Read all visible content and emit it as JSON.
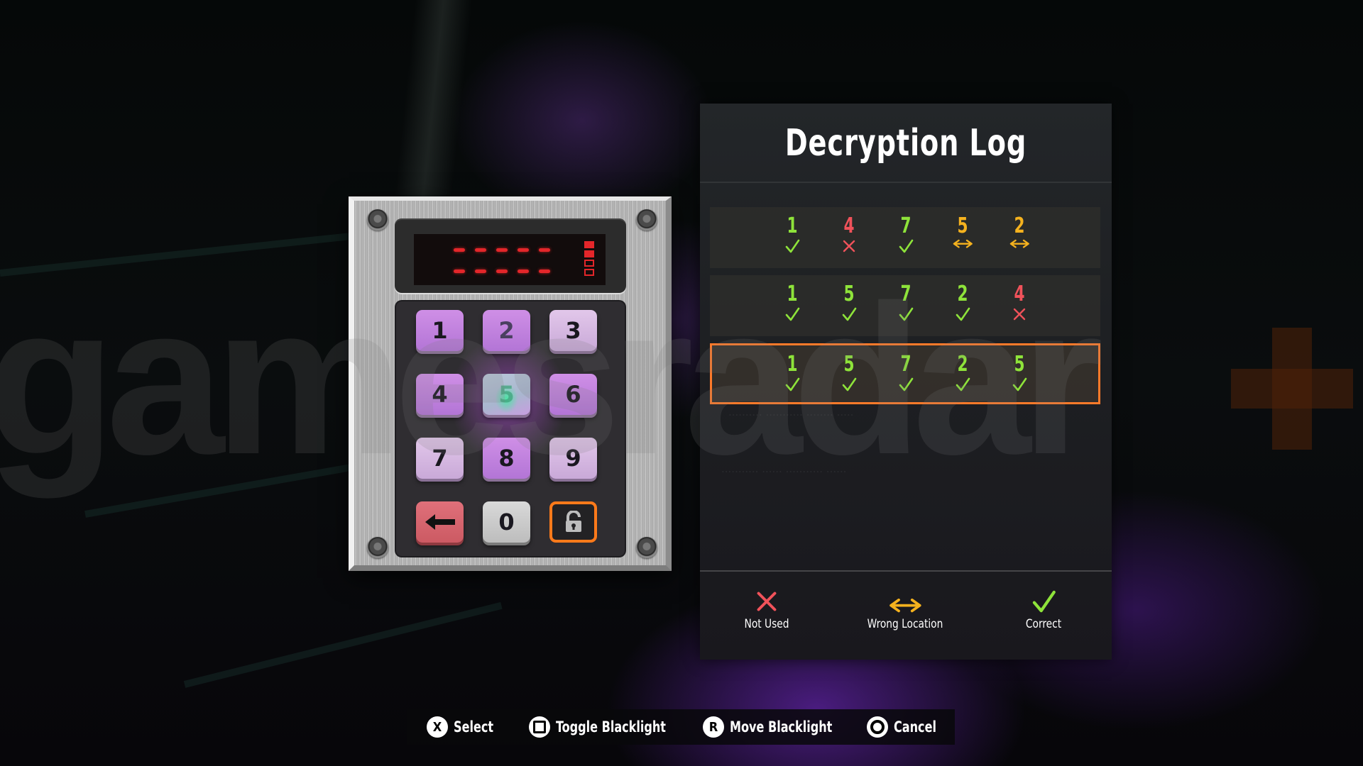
{
  "watermark": {
    "text": "gamesradar",
    "plus": "+"
  },
  "keypad": {
    "display": {
      "entered_digits": 0,
      "code_length": 5,
      "attempt_indicators": {
        "total": 4,
        "used": 2
      }
    },
    "keys": [
      {
        "label": "1",
        "state": "lit"
      },
      {
        "label": "2",
        "state": "print"
      },
      {
        "label": "3",
        "state": "normal"
      },
      {
        "label": "4",
        "state": "lit"
      },
      {
        "label": "5",
        "state": "print-strong"
      },
      {
        "label": "6",
        "state": "lit"
      },
      {
        "label": "7",
        "state": "normal"
      },
      {
        "label": "8",
        "state": "lit"
      },
      {
        "label": "9",
        "state": "normal"
      }
    ],
    "backspace_icon": "arrow-left-icon",
    "zero_label": "0",
    "enter_icon": "unlock-icon",
    "selected_key": "enter"
  },
  "log": {
    "title": "Decryption Log",
    "rows": [
      {
        "active": false,
        "entries": [
          {
            "digit": "1",
            "status": "correct"
          },
          {
            "digit": "4",
            "status": "not_used"
          },
          {
            "digit": "7",
            "status": "correct"
          },
          {
            "digit": "5",
            "status": "wrong_location"
          },
          {
            "digit": "2",
            "status": "wrong_location"
          }
        ]
      },
      {
        "active": false,
        "entries": [
          {
            "digit": "1",
            "status": "correct"
          },
          {
            "digit": "5",
            "status": "correct"
          },
          {
            "digit": "7",
            "status": "correct"
          },
          {
            "digit": "2",
            "status": "correct"
          },
          {
            "digit": "4",
            "status": "not_used"
          }
        ]
      },
      {
        "active": true,
        "entries": [
          {
            "digit": "1",
            "status": "correct"
          },
          {
            "digit": "5",
            "status": "correct"
          },
          {
            "digit": "7",
            "status": "correct"
          },
          {
            "digit": "2",
            "status": "correct"
          },
          {
            "digit": "5",
            "status": "correct"
          }
        ]
      }
    ],
    "legend": [
      {
        "key": "not_used",
        "label": "Not Used",
        "icon": "cross-icon"
      },
      {
        "key": "wrong_location",
        "label": "Wrong Location",
        "icon": "double-arrow-icon"
      },
      {
        "key": "correct",
        "label": "Correct",
        "icon": "checkmark-icon"
      }
    ]
  },
  "colors": {
    "correct": "#8ee33a",
    "not_used": "#f0525a",
    "wrong_location": "#f5b21e",
    "accent": "#ff7a1a"
  },
  "controls": [
    {
      "button": "X",
      "icon": "cross-button-icon",
      "label": "Select"
    },
    {
      "button": "□",
      "icon": "square-button-icon",
      "label": "Toggle Blacklight"
    },
    {
      "button": "R",
      "icon": "right-stick-icon",
      "label": "Move Blacklight"
    },
    {
      "button": "○",
      "icon": "circle-button-icon",
      "label": "Cancel"
    }
  ]
}
